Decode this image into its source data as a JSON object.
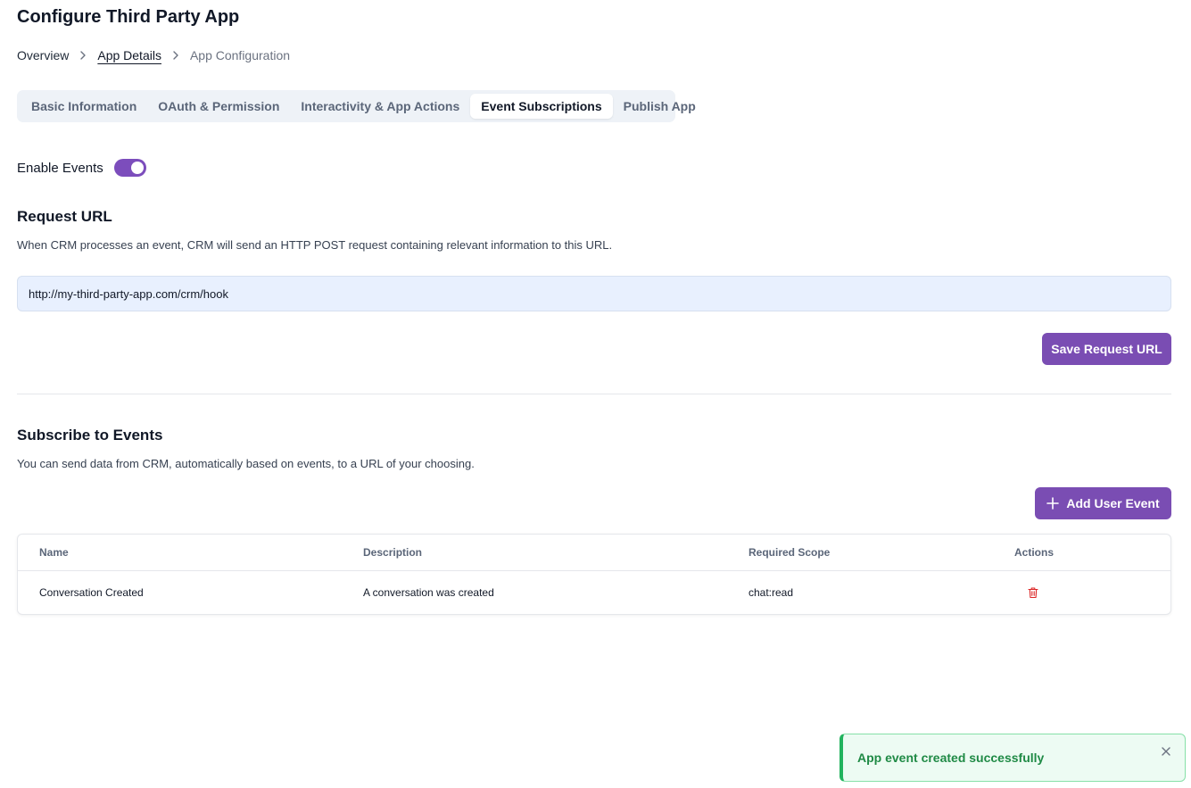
{
  "page": {
    "title": "Configure Third Party App"
  },
  "breadcrumb": {
    "items": [
      "Overview",
      "App Details",
      "App Configuration"
    ]
  },
  "tabs": [
    {
      "label": "Basic Information",
      "active": false
    },
    {
      "label": "OAuth & Permission",
      "active": false
    },
    {
      "label": "Interactivity & App Actions",
      "active": false
    },
    {
      "label": "Event Subscriptions",
      "active": true
    },
    {
      "label": "Publish App",
      "active": false
    }
  ],
  "events_toggle": {
    "label": "Enable Events",
    "enabled": true
  },
  "request_url": {
    "title": "Request URL",
    "description": "When CRM processes an event, CRM will send an HTTP POST request containing relevant information to this URL.",
    "value": "http://my-third-party-app.com/crm/hook",
    "save_label": "Save Request URL"
  },
  "subscribe": {
    "title": "Subscribe to Events",
    "description": "You can send data from CRM, automatically based on events, to a URL of your choosing.",
    "add_label": "Add User Event"
  },
  "table": {
    "columns": [
      "Name",
      "Description",
      "Required Scope",
      "Actions"
    ],
    "rows": [
      {
        "name": "Conversation Created",
        "description": "A conversation was created",
        "scope": "chat:read",
        "action_icon": "trash-icon"
      }
    ]
  },
  "toast": {
    "message": "App event created successfully",
    "type": "success"
  },
  "colors": {
    "accent": "#7a4db3",
    "success": "#22b35e",
    "delete": "#dc2626"
  }
}
